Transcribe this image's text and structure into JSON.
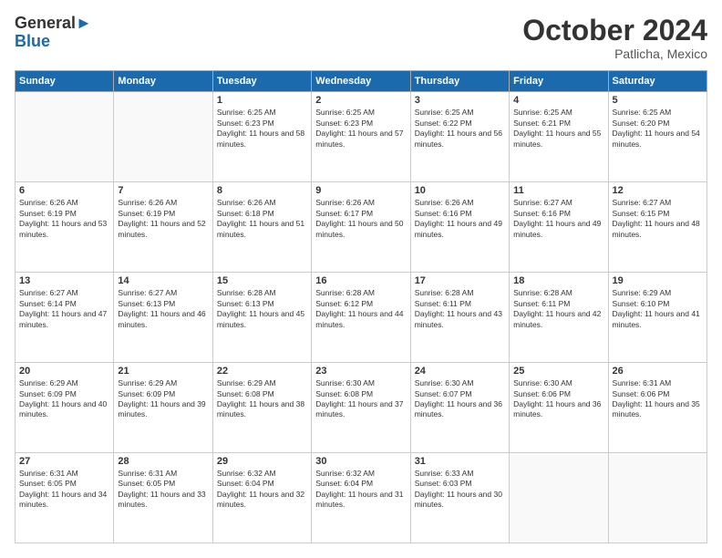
{
  "header": {
    "logo_line1": "General",
    "logo_line2": "Blue",
    "month": "October 2024",
    "location": "Patlicha, Mexico"
  },
  "weekdays": [
    "Sunday",
    "Monday",
    "Tuesday",
    "Wednesday",
    "Thursday",
    "Friday",
    "Saturday"
  ],
  "weeks": [
    [
      {
        "day": "",
        "detail": ""
      },
      {
        "day": "",
        "detail": ""
      },
      {
        "day": "1",
        "detail": "Sunrise: 6:25 AM\nSunset: 6:23 PM\nDaylight: 11 hours and 58 minutes."
      },
      {
        "day": "2",
        "detail": "Sunrise: 6:25 AM\nSunset: 6:23 PM\nDaylight: 11 hours and 57 minutes."
      },
      {
        "day": "3",
        "detail": "Sunrise: 6:25 AM\nSunset: 6:22 PM\nDaylight: 11 hours and 56 minutes."
      },
      {
        "day": "4",
        "detail": "Sunrise: 6:25 AM\nSunset: 6:21 PM\nDaylight: 11 hours and 55 minutes."
      },
      {
        "day": "5",
        "detail": "Sunrise: 6:25 AM\nSunset: 6:20 PM\nDaylight: 11 hours and 54 minutes."
      }
    ],
    [
      {
        "day": "6",
        "detail": "Sunrise: 6:26 AM\nSunset: 6:19 PM\nDaylight: 11 hours and 53 minutes."
      },
      {
        "day": "7",
        "detail": "Sunrise: 6:26 AM\nSunset: 6:19 PM\nDaylight: 11 hours and 52 minutes."
      },
      {
        "day": "8",
        "detail": "Sunrise: 6:26 AM\nSunset: 6:18 PM\nDaylight: 11 hours and 51 minutes."
      },
      {
        "day": "9",
        "detail": "Sunrise: 6:26 AM\nSunset: 6:17 PM\nDaylight: 11 hours and 50 minutes."
      },
      {
        "day": "10",
        "detail": "Sunrise: 6:26 AM\nSunset: 6:16 PM\nDaylight: 11 hours and 49 minutes."
      },
      {
        "day": "11",
        "detail": "Sunrise: 6:27 AM\nSunset: 6:16 PM\nDaylight: 11 hours and 49 minutes."
      },
      {
        "day": "12",
        "detail": "Sunrise: 6:27 AM\nSunset: 6:15 PM\nDaylight: 11 hours and 48 minutes."
      }
    ],
    [
      {
        "day": "13",
        "detail": "Sunrise: 6:27 AM\nSunset: 6:14 PM\nDaylight: 11 hours and 47 minutes."
      },
      {
        "day": "14",
        "detail": "Sunrise: 6:27 AM\nSunset: 6:13 PM\nDaylight: 11 hours and 46 minutes."
      },
      {
        "day": "15",
        "detail": "Sunrise: 6:28 AM\nSunset: 6:13 PM\nDaylight: 11 hours and 45 minutes."
      },
      {
        "day": "16",
        "detail": "Sunrise: 6:28 AM\nSunset: 6:12 PM\nDaylight: 11 hours and 44 minutes."
      },
      {
        "day": "17",
        "detail": "Sunrise: 6:28 AM\nSunset: 6:11 PM\nDaylight: 11 hours and 43 minutes."
      },
      {
        "day": "18",
        "detail": "Sunrise: 6:28 AM\nSunset: 6:11 PM\nDaylight: 11 hours and 42 minutes."
      },
      {
        "day": "19",
        "detail": "Sunrise: 6:29 AM\nSunset: 6:10 PM\nDaylight: 11 hours and 41 minutes."
      }
    ],
    [
      {
        "day": "20",
        "detail": "Sunrise: 6:29 AM\nSunset: 6:09 PM\nDaylight: 11 hours and 40 minutes."
      },
      {
        "day": "21",
        "detail": "Sunrise: 6:29 AM\nSunset: 6:09 PM\nDaylight: 11 hours and 39 minutes."
      },
      {
        "day": "22",
        "detail": "Sunrise: 6:29 AM\nSunset: 6:08 PM\nDaylight: 11 hours and 38 minutes."
      },
      {
        "day": "23",
        "detail": "Sunrise: 6:30 AM\nSunset: 6:08 PM\nDaylight: 11 hours and 37 minutes."
      },
      {
        "day": "24",
        "detail": "Sunrise: 6:30 AM\nSunset: 6:07 PM\nDaylight: 11 hours and 36 minutes."
      },
      {
        "day": "25",
        "detail": "Sunrise: 6:30 AM\nSunset: 6:06 PM\nDaylight: 11 hours and 36 minutes."
      },
      {
        "day": "26",
        "detail": "Sunrise: 6:31 AM\nSunset: 6:06 PM\nDaylight: 11 hours and 35 minutes."
      }
    ],
    [
      {
        "day": "27",
        "detail": "Sunrise: 6:31 AM\nSunset: 6:05 PM\nDaylight: 11 hours and 34 minutes."
      },
      {
        "day": "28",
        "detail": "Sunrise: 6:31 AM\nSunset: 6:05 PM\nDaylight: 11 hours and 33 minutes."
      },
      {
        "day": "29",
        "detail": "Sunrise: 6:32 AM\nSunset: 6:04 PM\nDaylight: 11 hours and 32 minutes."
      },
      {
        "day": "30",
        "detail": "Sunrise: 6:32 AM\nSunset: 6:04 PM\nDaylight: 11 hours and 31 minutes."
      },
      {
        "day": "31",
        "detail": "Sunrise: 6:33 AM\nSunset: 6:03 PM\nDaylight: 11 hours and 30 minutes."
      },
      {
        "day": "",
        "detail": ""
      },
      {
        "day": "",
        "detail": ""
      }
    ]
  ]
}
